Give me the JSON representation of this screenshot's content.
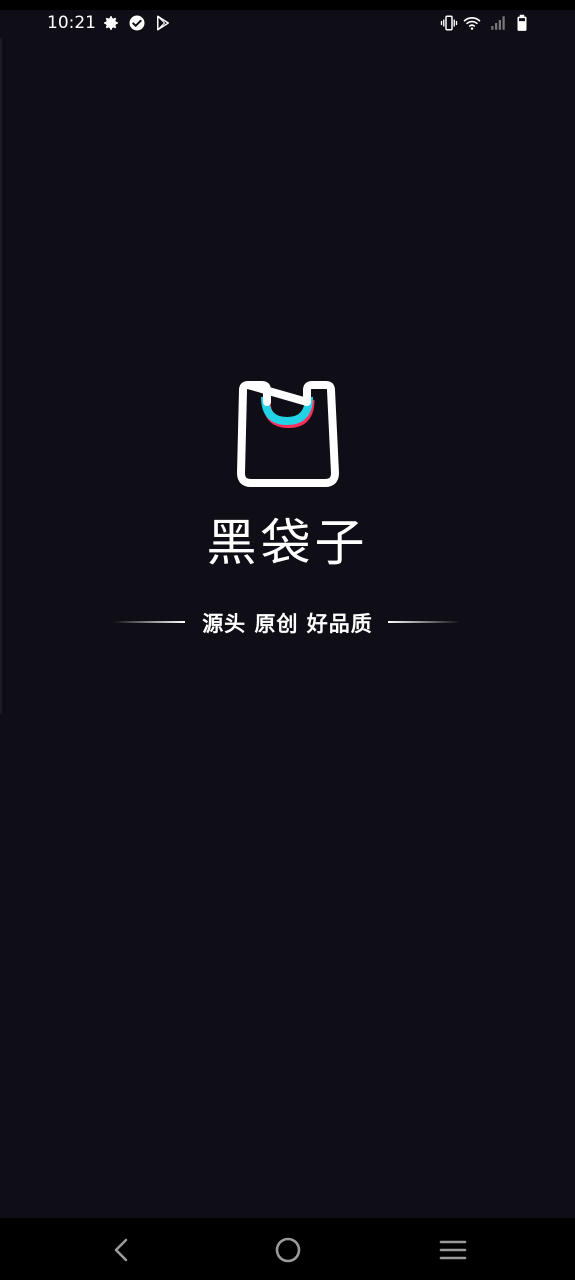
{
  "status_bar": {
    "time": "10:21",
    "left_icons": [
      "gear-icon",
      "check-circle-icon",
      "play-store-icon"
    ],
    "right_icons": [
      "vibrate-icon",
      "wifi-icon",
      "signal-icon",
      "battery-icon"
    ]
  },
  "splash": {
    "logo_icon": "shopping-bag-icon",
    "brand_name": "黑袋子",
    "slogan": "源头 原创 好品质"
  },
  "colors": {
    "background": "#0f0e16",
    "logo_outline": "#ffffff",
    "logo_accent_cyan": "#22d3e6",
    "logo_accent_pink": "#ff2d5a"
  },
  "nav_bar": {
    "buttons": [
      "back-icon",
      "home-icon",
      "recents-icon"
    ]
  }
}
